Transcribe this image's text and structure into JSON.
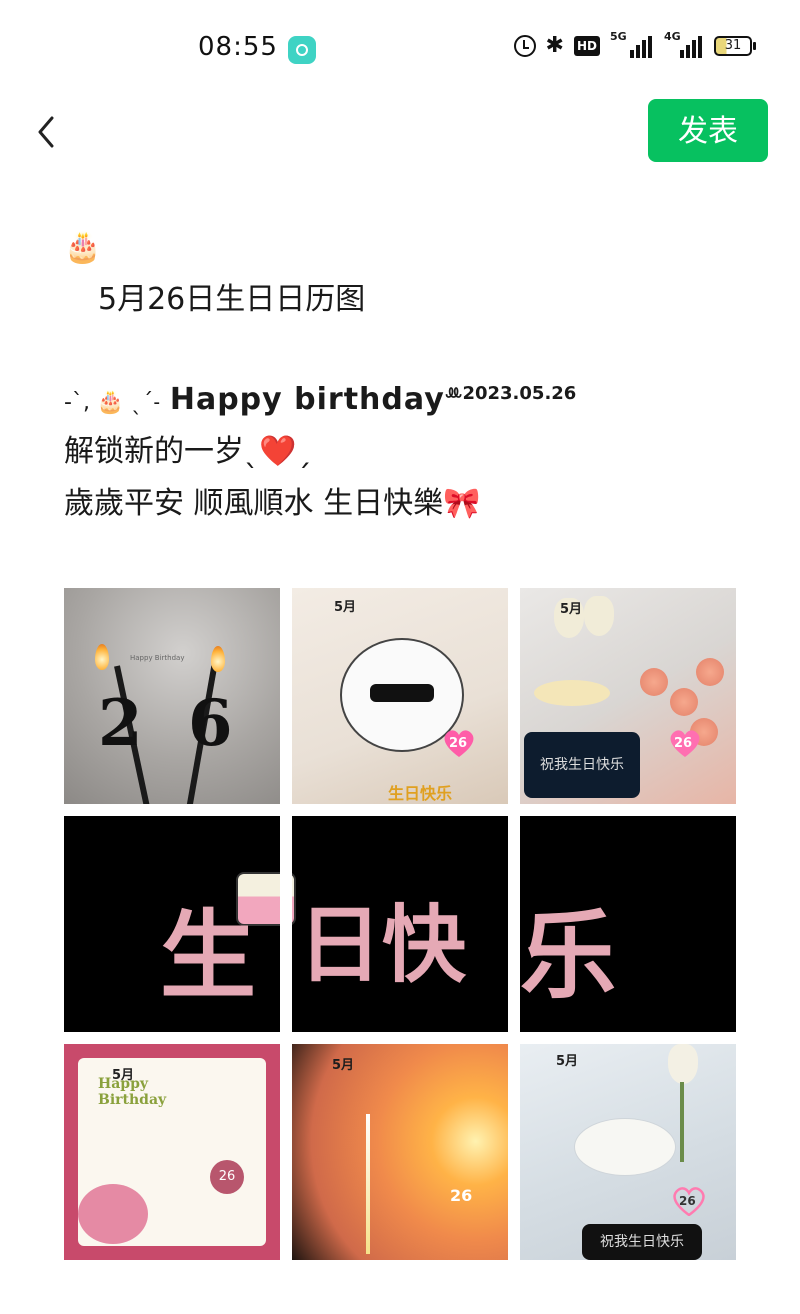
{
  "status_bar": {
    "time": "08:55",
    "network_1": "5G",
    "network_2": "4G",
    "hd_badge": "HD",
    "battery": "31"
  },
  "header": {
    "publish_label": "发表"
  },
  "post": {
    "emoji_top": "🎂",
    "title": "5月26日生日日历图",
    "hb_prefix": "-`, 🎂 ˎˊ˗",
    "hb_text": "Happy  birthday",
    "hb_mark": "ꔛ",
    "hb_date": "2023.05.26",
    "line1": "解锁新的一岁ˎ❤️ˏ",
    "line2": "歲歲平安 顺風順水 生日快樂🎀"
  },
  "images": {
    "tile1": {
      "candle_left": "2",
      "candle_right": "6",
      "caption": "Happy Birthday"
    },
    "tile2": {
      "month": "5月",
      "highlight": "26",
      "footer": "生日快乐"
    },
    "tile3": {
      "month": "5月",
      "highlight": "26",
      "phone_text": "祝我生日快乐"
    },
    "tile4": {
      "brush_text": "生"
    },
    "tile5": {
      "brush_text": "日快"
    },
    "tile6": {
      "brush_text": "乐"
    },
    "tile7": {
      "month": "5月",
      "title": "Happy Birthday",
      "highlight": "26"
    },
    "tile8": {
      "month": "5月",
      "highlight": "26"
    },
    "tile9": {
      "month": "5月",
      "highlight": "26",
      "phone_text": "祝我生日快乐"
    }
  },
  "colors": {
    "publish_button": "#07c160",
    "background": "#ffffff"
  },
  "icons": {
    "back": "chevron-left-icon",
    "alarm": "alarm-icon",
    "bluetooth": "bluetooth-icon"
  }
}
